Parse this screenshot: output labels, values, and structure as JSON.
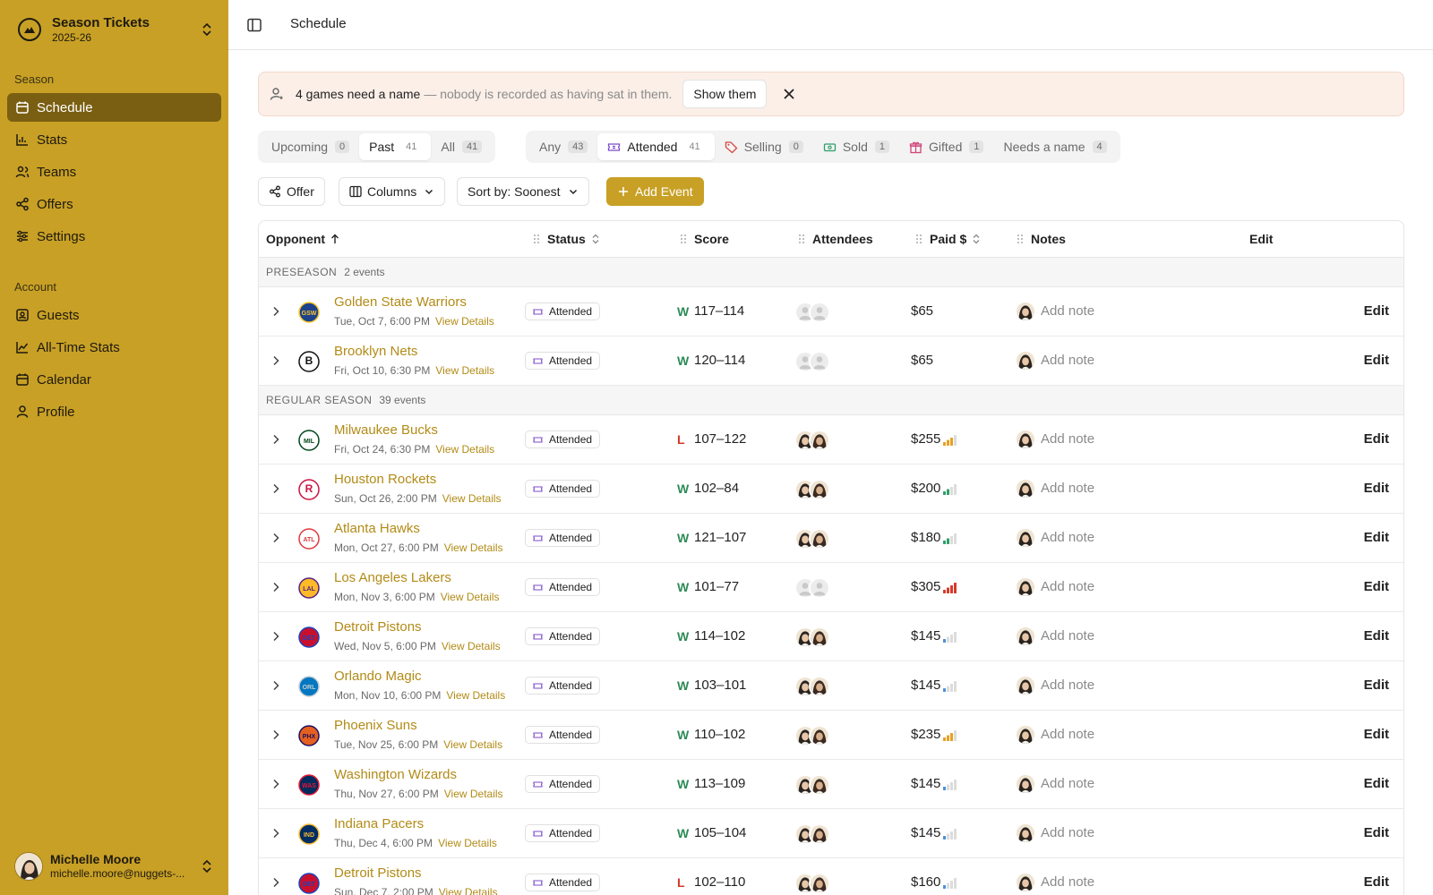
{
  "sidebar": {
    "brand": {
      "title": "Season Tickets",
      "subtitle": "2025-26"
    },
    "sections": [
      {
        "label": "Season",
        "items": [
          {
            "label": "Schedule",
            "icon": "calendar-icon",
            "active": true
          },
          {
            "label": "Stats",
            "icon": "bar-chart-icon"
          },
          {
            "label": "Teams",
            "icon": "users-icon"
          },
          {
            "label": "Offers",
            "icon": "share-icon"
          },
          {
            "label": "Settings",
            "icon": "sliders-icon"
          }
        ]
      },
      {
        "label": "Account",
        "items": [
          {
            "label": "Guests",
            "icon": "contact-card-icon"
          },
          {
            "label": "All-Time Stats",
            "icon": "line-chart-icon"
          },
          {
            "label": "Calendar",
            "icon": "calendar-icon"
          },
          {
            "label": "Profile",
            "icon": "user-icon"
          }
        ]
      }
    ],
    "user": {
      "name": "Michelle Moore",
      "email": "michelle.moore@nuggets-..."
    }
  },
  "topbar": {
    "breadcrumb": "Schedule"
  },
  "banner": {
    "strong": "4 games need a name",
    "muted": "— nobody is recorded as having sat in them.",
    "button": "Show them"
  },
  "filters": {
    "time": [
      {
        "label": "Upcoming",
        "count": "0",
        "active": false
      },
      {
        "label": "Past",
        "count": "41",
        "active": true
      },
      {
        "label": "All",
        "count": "41",
        "active": false
      }
    ],
    "status": [
      {
        "label": "Any",
        "count": "43",
        "active": false,
        "icon": ""
      },
      {
        "label": "Attended",
        "count": "41",
        "active": true,
        "icon": "ticket-icon"
      },
      {
        "label": "Selling",
        "count": "0",
        "active": false,
        "icon": "tag-icon"
      },
      {
        "label": "Sold",
        "count": "1",
        "active": false,
        "icon": "cash-icon"
      },
      {
        "label": "Gifted",
        "count": "1",
        "active": false,
        "icon": "gift-icon"
      },
      {
        "label": "Needs a name",
        "count": "4",
        "active": false,
        "icon": ""
      }
    ]
  },
  "toolbar": {
    "offer": "Offer",
    "columns": "Columns",
    "sort": "Sort by: Soonest",
    "add": "Add Event"
  },
  "table": {
    "headers": {
      "opponent": "Opponent",
      "status": "Status",
      "score": "Score",
      "attendees": "Attendees",
      "paid": "Paid $",
      "notes": "Notes",
      "edit": "Edit"
    },
    "groups": [
      {
        "name": "PRESEASON",
        "count": "2 events",
        "rows": [
          {
            "team": "Golden State Warriors",
            "date": "Tue, Oct 7, 6:00 PM",
            "status": "Attended",
            "result": "W",
            "score": "117–114",
            "attendees": "placeholder",
            "paid": "$65",
            "price_level": 0,
            "price_color": "",
            "logo": "#1d428a",
            "logo2": "#ffc72c",
            "glyph": "GSW"
          },
          {
            "team": "Brooklyn Nets",
            "date": "Fri, Oct 10, 6:30 PM",
            "status": "Attended",
            "result": "W",
            "score": "120–114",
            "attendees": "placeholder",
            "paid": "$65",
            "price_level": 0,
            "price_color": "",
            "logo": "#ffffff",
            "logo2": "#111111",
            "glyph": "B"
          }
        ]
      },
      {
        "name": "REGULAR SEASON",
        "count": "39 events",
        "rows": [
          {
            "team": "Milwaukee Bucks",
            "date": "Fri, Oct 24, 6:30 PM",
            "status": "Attended",
            "result": "L",
            "score": "107–122",
            "attendees": "faces",
            "paid": "$255",
            "price_level": 3,
            "price_color": "#e8a020",
            "logo": "#ffffff",
            "logo2": "#00471b",
            "glyph": "MIL"
          },
          {
            "team": "Houston Rockets",
            "date": "Sun, Oct 26, 2:00 PM",
            "status": "Attended",
            "result": "W",
            "score": "102–84",
            "attendees": "faces",
            "paid": "$200",
            "price_level": 2,
            "price_color": "#2e9e6a",
            "logo": "#ffffff",
            "logo2": "#ce1141",
            "glyph": "R"
          },
          {
            "team": "Atlanta Hawks",
            "date": "Mon, Oct 27, 6:00 PM",
            "status": "Attended",
            "result": "W",
            "score": "121–107",
            "attendees": "faces",
            "paid": "$180",
            "price_level": 2,
            "price_color": "#2e9e6a",
            "logo": "#ffffff",
            "logo2": "#e03a3e",
            "glyph": "ATL"
          },
          {
            "team": "Los Angeles Lakers",
            "date": "Mon, Nov 3, 6:00 PM",
            "status": "Attended",
            "result": "W",
            "score": "101–77",
            "attendees": "placeholder",
            "paid": "$305",
            "price_level": 4,
            "price_color": "#d83a2a",
            "logo": "#fdb927",
            "logo2": "#552583",
            "glyph": "LAL"
          },
          {
            "team": "Detroit Pistons",
            "date": "Wed, Nov 5, 6:00 PM",
            "status": "Attended",
            "result": "W",
            "score": "114–102",
            "attendees": "faces",
            "paid": "$145",
            "price_level": 1,
            "price_color": "#4a90d9",
            "logo": "#c8102e",
            "logo2": "#1d42ba",
            "glyph": "DET"
          },
          {
            "team": "Orlando Magic",
            "date": "Mon, Nov 10, 6:00 PM",
            "status": "Attended",
            "result": "W",
            "score": "103–101",
            "attendees": "faces",
            "paid": "$145",
            "price_level": 1,
            "price_color": "#4a90d9",
            "logo": "#0077c0",
            "logo2": "#c4ced4",
            "glyph": "ORL"
          },
          {
            "team": "Phoenix Suns",
            "date": "Tue, Nov 25, 6:00 PM",
            "status": "Attended",
            "result": "W",
            "score": "110–102",
            "attendees": "faces",
            "paid": "$235",
            "price_level": 3,
            "price_color": "#e8a020",
            "logo": "#e56020",
            "logo2": "#1d1160",
            "glyph": "PHX"
          },
          {
            "team": "Washington Wizards",
            "date": "Thu, Nov 27, 6:00 PM",
            "status": "Attended",
            "result": "W",
            "score": "113–109",
            "attendees": "faces",
            "paid": "$145",
            "price_level": 1,
            "price_color": "#4a90d9",
            "logo": "#002b5c",
            "logo2": "#e31837",
            "glyph": "WAS"
          },
          {
            "team": "Indiana Pacers",
            "date": "Thu, Dec 4, 6:00 PM",
            "status": "Attended",
            "result": "W",
            "score": "105–104",
            "attendees": "faces",
            "paid": "$145",
            "price_level": 1,
            "price_color": "#4a90d9",
            "logo": "#002d62",
            "logo2": "#fdbb30",
            "glyph": "IND"
          },
          {
            "team": "Detroit Pistons",
            "date": "Sun, Dec 7, 2:00 PM",
            "status": "Attended",
            "result": "L",
            "score": "102–110",
            "attendees": "faces",
            "paid": "$160",
            "price_level": 1,
            "price_color": "#4a90d9",
            "logo": "#c8102e",
            "logo2": "#1d42ba",
            "glyph": "DET"
          }
        ]
      }
    ],
    "row_labels": {
      "view_details": "View Details",
      "add_note": "Add note",
      "edit": "Edit"
    }
  },
  "colors": {
    "accent": "#c8a025",
    "accent_dark": "#7a5f12",
    "win": "#2e8b57",
    "loss": "#d23b2a",
    "link": "#b28b16"
  }
}
